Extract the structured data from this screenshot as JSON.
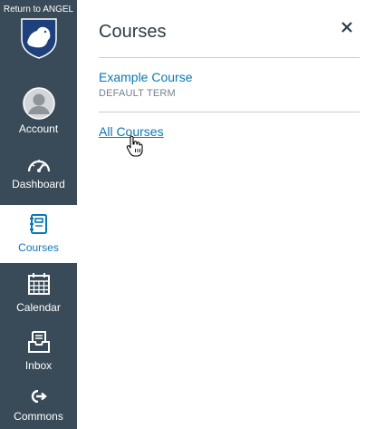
{
  "nav": {
    "return_link": "Return to ANGEL",
    "items": [
      {
        "label": "Account",
        "icon": "avatar-icon"
      },
      {
        "label": "Dashboard",
        "icon": "speedometer-icon"
      },
      {
        "label": "Courses",
        "icon": "book-icon",
        "active": true
      },
      {
        "label": "Calendar",
        "icon": "calendar-icon"
      },
      {
        "label": "Inbox",
        "icon": "inbox-icon"
      },
      {
        "label": "Commons",
        "icon": "commons-icon"
      }
    ]
  },
  "tray": {
    "title": "Courses",
    "close_icon": "close-icon",
    "courses": [
      {
        "name": "Example Course",
        "term": "DEFAULT TERM"
      }
    ],
    "all_courses_label": "All Courses"
  },
  "colors": {
    "nav_bg": "#394b58",
    "accent": "#0a78b4",
    "logo_blue": "#1e407c",
    "text_dark": "#2d3b45",
    "text_muted": "#73818c"
  }
}
